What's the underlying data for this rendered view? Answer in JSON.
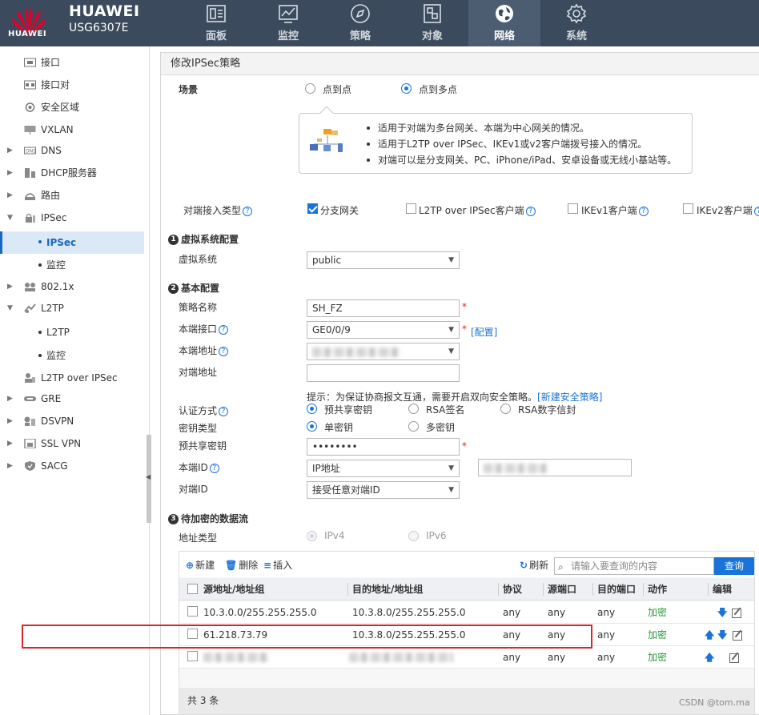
{
  "brand": {
    "logo_text": "HUAWEI",
    "name": "HUAWEI",
    "model": "USG6307E"
  },
  "nav": [
    {
      "label": "面板",
      "icon": "dashboard-icon"
    },
    {
      "label": "监控",
      "icon": "monitor-chart-icon"
    },
    {
      "label": "策略",
      "icon": "compass-icon"
    },
    {
      "label": "对象",
      "icon": "object-icon"
    },
    {
      "label": "网络",
      "icon": "globe-network-icon",
      "active": true
    },
    {
      "label": "系统",
      "icon": "gear-icon"
    }
  ],
  "sidebar": {
    "items": [
      {
        "label": "接口",
        "icon": "interface-icon"
      },
      {
        "label": "接口对",
        "icon": "interface-pair-icon"
      },
      {
        "label": "安全区域",
        "icon": "security-zone-icon"
      },
      {
        "label": "VXLAN",
        "icon": "vxlan-icon"
      },
      {
        "label": "DNS",
        "icon": "dns-icon"
      },
      {
        "label": "DHCP服务器",
        "icon": "dhcp-server-icon"
      },
      {
        "label": "路由",
        "icon": "router-icon"
      },
      {
        "label": "IPSec",
        "icon": "ipsec-icon"
      },
      {
        "label": "IPSec",
        "sub": true
      },
      {
        "label": "监控",
        "sub": true
      },
      {
        "label": "802.1x",
        "icon": "8021x-icon"
      },
      {
        "label": "L2TP",
        "icon": "l2tp-icon"
      },
      {
        "label": "L2TP",
        "sub": true
      },
      {
        "label": "监控",
        "sub": true
      },
      {
        "label": "L2TP over IPSec",
        "icon": "l2tp-over-ipsec-icon"
      },
      {
        "label": "GRE",
        "icon": "gre-icon"
      },
      {
        "label": "DSVPN",
        "icon": "dsvpn-icon"
      },
      {
        "label": "SSL VPN",
        "icon": "ssl-vpn-icon"
      },
      {
        "label": "SACG",
        "icon": "sacg-icon"
      }
    ]
  },
  "page": {
    "title": "修改IPSec策略",
    "scenario": {
      "label": "场景",
      "opt_p2p": "点到点",
      "opt_p2mp": "点到多点"
    },
    "info": [
      "适用于对端为多台网关、本端为中心网关的情况。",
      "适用于L2TP over IPSec、IKEv1或v2客户端拨号接入的情况。",
      "对端可以是分支网关、PC、iPhone/iPad、安卓设备或无线小基站等。"
    ],
    "peer_type": {
      "label": "对端接入类型",
      "opt1": "分支网关",
      "opt2": "L2TP over IPSec客户端",
      "opt3": "IKEv1客户端",
      "opt4": "IKEv2客户端"
    },
    "section1": {
      "num": "1",
      "title": "虚拟系统配置",
      "vsys_label": "虚拟系统",
      "vsys_value": "public"
    },
    "section2": {
      "num": "2",
      "title": "基本配置",
      "policy_name_label": "策略名称",
      "policy_name_value": "SH_FZ",
      "local_if_label": "本端接口",
      "local_if_value": "GE0/0/9",
      "config_link": "[配置]",
      "local_addr_label": "本端地址",
      "peer_addr_label": "对端地址",
      "hint": "提示：为保证协商报文互通，需要开启双向安全策略。",
      "hint_link": "[新建安全策略]",
      "auth_label": "认证方式",
      "auth_psk": "预共享密钥",
      "auth_rsa": "RSA签名",
      "auth_cert": "RSA数字信封",
      "key_type_label": "密钥类型",
      "key_single": "单密钥",
      "key_multi": "多密钥",
      "psk_label": "预共享密钥",
      "psk_value": "••••••••",
      "local_id_label": "本端ID",
      "local_id_value": "IP地址",
      "peer_id_label": "对端ID",
      "peer_id_value": "接受任意对端ID"
    },
    "section3": {
      "num": "3",
      "title": "待加密的数据流",
      "addr_type_label": "地址类型",
      "ipv4": "IPv4",
      "ipv6": "IPv6"
    }
  },
  "table": {
    "toolbar": {
      "new": "新建",
      "delete": "删除",
      "insert": "插入",
      "refresh": "刷新",
      "search_placeholder": "请输入要查询的内容",
      "query": "查询"
    },
    "columns": [
      "源地址/地址组",
      "目的地址/地址组",
      "协议",
      "源端口",
      "目的端口",
      "动作",
      "编辑"
    ],
    "rows": [
      {
        "src": "10.3.0.0/255.255.255.0",
        "dst": "10.3.8.0/255.255.255.0",
        "proto": "any",
        "sport": "any",
        "dport": "any",
        "action": "加密"
      },
      {
        "src": "61.218.73.79",
        "dst": "10.3.8.0/255.255.255.0",
        "proto": "any",
        "sport": "any",
        "dport": "any",
        "action": "加密"
      },
      {
        "src": "",
        "dst": "",
        "proto": "any",
        "sport": "any",
        "dport": "any",
        "action": "加密"
      }
    ],
    "footer": "共 3 条"
  },
  "watermark": "CSDN @tom.ma",
  "colors": {
    "topbar": "#3b4a5d",
    "accent": "#1a73d9",
    "green": "#2a9a3a",
    "highlight": "#d9262c"
  }
}
